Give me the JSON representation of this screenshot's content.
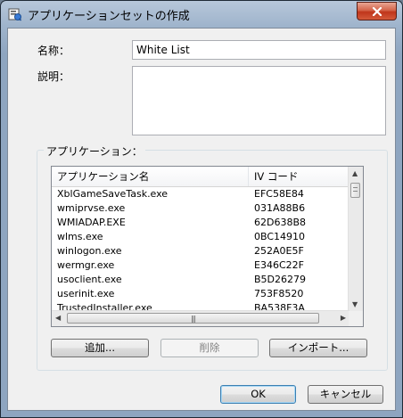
{
  "window": {
    "title": "アプリケーションセットの作成"
  },
  "form": {
    "name_label": "名称：",
    "name_value": "White List",
    "description_label": "説明：",
    "description_value": ""
  },
  "applications": {
    "group_label": "アプリケーション：",
    "columns": [
      "アプリケーション名",
      "IV コード"
    ],
    "rows": [
      {
        "name": "XblGameSaveTask.exe",
        "code": "EFC58E84"
      },
      {
        "name": "wmiprvse.exe",
        "code": "031A88B6"
      },
      {
        "name": "WMIADAP.EXE",
        "code": "62D638B8"
      },
      {
        "name": "wlms.exe",
        "code": "0BC14910"
      },
      {
        "name": "winlogon.exe",
        "code": "252A0E5F"
      },
      {
        "name": "wermgr.exe",
        "code": "E346C22F"
      },
      {
        "name": "usoclient.exe",
        "code": "B5D26279"
      },
      {
        "name": "userinit.exe",
        "code": "753F8520"
      },
      {
        "name": "TrustedInstaller.exe",
        "code": "BA538F3A"
      }
    ],
    "buttons": {
      "add": "追加...",
      "delete": "削除",
      "import": "インポート..."
    }
  },
  "dialog_buttons": {
    "ok": "OK",
    "cancel": "キャンセル"
  }
}
